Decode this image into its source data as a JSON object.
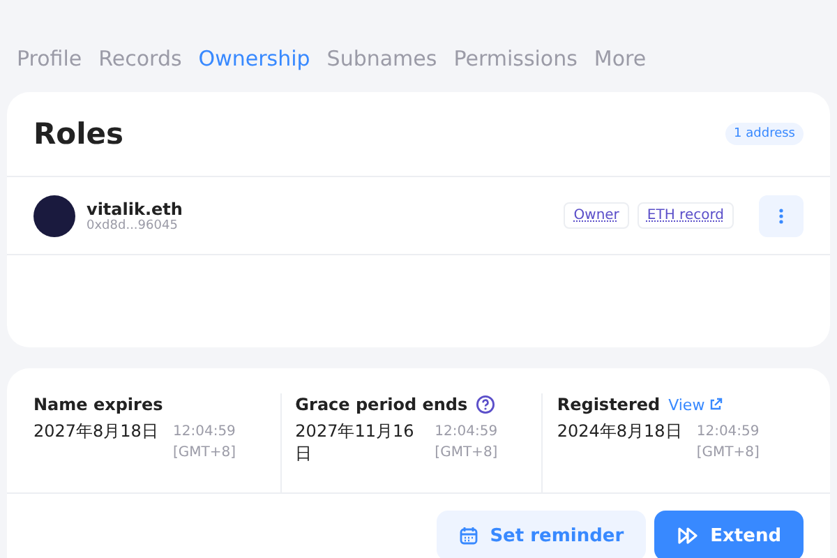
{
  "tabs": [
    {
      "label": "Profile",
      "selected": false
    },
    {
      "label": "Records",
      "selected": false
    },
    {
      "label": "Ownership",
      "selected": true
    },
    {
      "label": "Subnames",
      "selected": false
    },
    {
      "label": "Permissions",
      "selected": false
    },
    {
      "label": "More",
      "selected": false
    }
  ],
  "roles": {
    "title": "Roles",
    "count": "1 address",
    "items": [
      {
        "name": "vitalik.eth",
        "address": "0xd8d...96045",
        "tags": [
          "Owner",
          "ETH record"
        ]
      }
    ]
  },
  "dates": [
    {
      "label": "Name expires",
      "date": "2027年8月18日",
      "time": "12:04:59",
      "zone": "[GMT+8]",
      "help": false
    },
    {
      "label": "Grace period ends",
      "date": "2027年11月16日",
      "time": "12:04:59",
      "zone": "[GMT+8]",
      "help": true
    },
    {
      "label": "Registered",
      "link": "View",
      "date": "2024年8月18日",
      "time": "12:04:59",
      "zone": "[GMT+8]",
      "help": false
    }
  ],
  "actions": [
    {
      "label": "Set reminder",
      "kind": "secondary"
    },
    {
      "label": "Extend",
      "kind": "primary"
    }
  ]
}
